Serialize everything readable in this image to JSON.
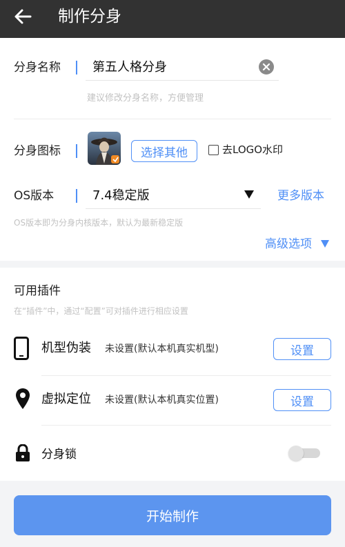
{
  "header": {
    "title": "制作分身"
  },
  "name_row": {
    "label": "分身名称",
    "value": "第五人格分身",
    "hint": "建议修改分身名称，方便管理"
  },
  "icon_row": {
    "label": "分身图标",
    "choose_other": "选择其他",
    "remove_logo": "去LOGO水印",
    "remove_logo_checked": false
  },
  "os_row": {
    "label": "OS版本",
    "value": "7.4稳定版",
    "more_versions": "更多版本",
    "hint": "OS版本即为分身内核版本，默认为最新稳定版"
  },
  "advanced": {
    "label": "高级选项"
  },
  "plugins": {
    "title": "可用插件",
    "hint": "在“插件”中，通过“配置”可对插件进行相应设置",
    "items": [
      {
        "icon": "phone-icon",
        "label": "机型伪装",
        "status": "未设置(默认本机真实机型)",
        "button": "设置"
      },
      {
        "icon": "location-pin-icon",
        "label": "虚拟定位",
        "status": "未设置(默认本机真实位置)",
        "button": "设置"
      }
    ],
    "lock": {
      "icon": "lock-icon",
      "label": "分身锁",
      "enabled": false
    }
  },
  "footer": {
    "start_button": "开始制作"
  },
  "colors": {
    "accent": "#4f8ff6",
    "topbar": "#323232",
    "start_button": "#5c95ef"
  }
}
